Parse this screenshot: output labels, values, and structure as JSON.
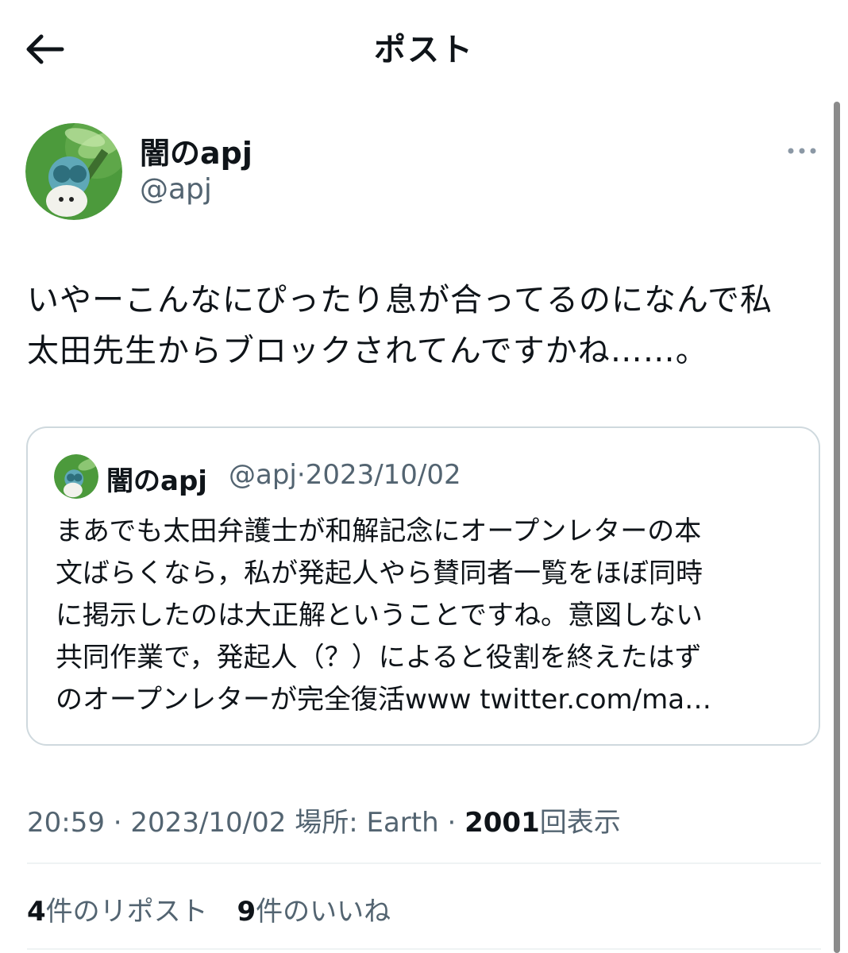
{
  "header": {
    "title": "ポスト",
    "back_icon": "arrow-left-icon"
  },
  "post": {
    "author": {
      "name": "闇のapj",
      "handle": "@apj",
      "avatar_icon": "dragonfly-avatar"
    },
    "more_icon": "more-horizontal-icon",
    "text": "いやーこんなにぴったり息が合ってるのになんで私\n太田先生からブロックされてんですかね……。",
    "quote": {
      "author_name": "闇のapj",
      "handle": "@apj",
      "separator": "·",
      "date": "2023/10/02",
      "text": "まあでも太田弁護士が和解記念にオープンレターの本\n文ばらくなら，私が発起人やら賛同者一覧をほぼ同時\nに掲示したのは大正解ということですね。意図しない\n共同作業で，発起人（？）によると役割を終えたはず\nのオープンレターが完全復活www twitter.com/ma…"
    },
    "meta": {
      "time": "20:59",
      "separator": "·",
      "date": "2023/10/02",
      "location_label": "場所: Earth",
      "views_count": "2001",
      "views_label": "回表示"
    },
    "stats": {
      "reposts_count": "4",
      "reposts_label": "件のリポスト",
      "likes_count": "9",
      "likes_label": "件のいいね"
    }
  },
  "colors": {
    "text": "#0f1419",
    "secondary": "#536471",
    "border": "#cfd9de",
    "divider": "#eff3f4",
    "avatar_green": "#3f8c33"
  }
}
